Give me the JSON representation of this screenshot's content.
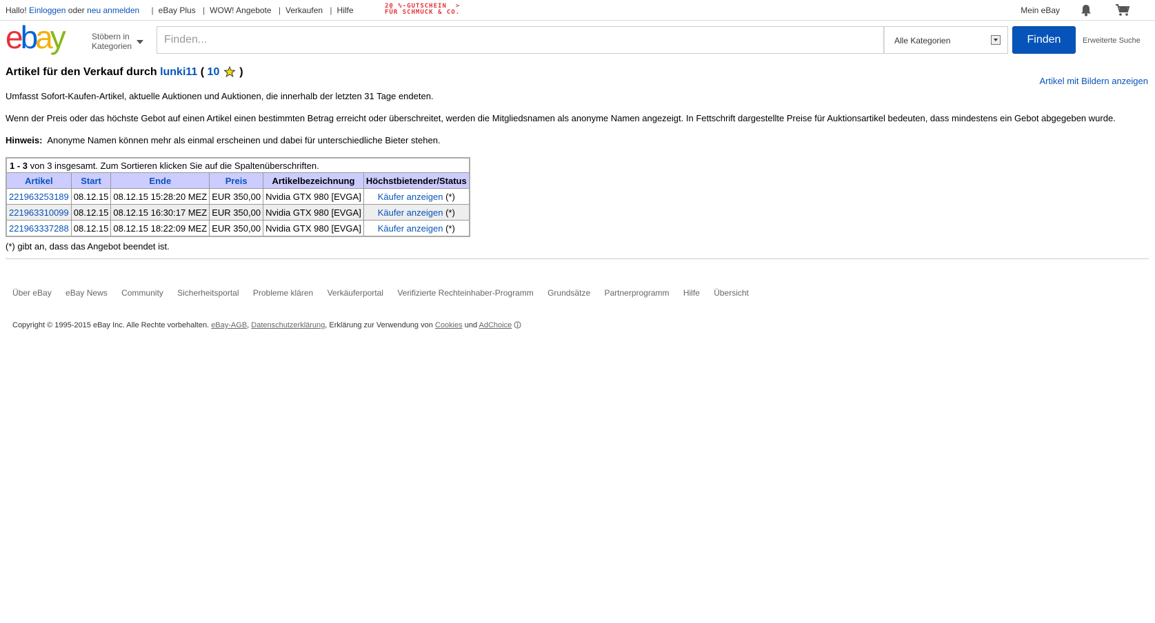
{
  "topbar": {
    "greeting": "Hallo!",
    "login": "Einloggen",
    "or": "oder",
    "register": "neu anmelden",
    "links": [
      "eBay Plus",
      "WOW! Angebote",
      "Verkaufen",
      "Hilfe"
    ],
    "promo_line1": "20 %-GUTSCHEIN  >",
    "promo_line2": "FÜR SCHMUCK & CO.",
    "mein_ebay": "Mein eBay"
  },
  "header": {
    "browse_line1": "Stöbern in",
    "browse_line2": "Kategorien",
    "search_placeholder": "Finden...",
    "category": "Alle Kategorien",
    "find_button": "Finden",
    "advanced": "Erweiterte Suche"
  },
  "page": {
    "title_prefix": "Artikel für den Verkauf durch",
    "seller": "lunki11",
    "open_paren": "(",
    "rating": "10",
    "close_paren": ")",
    "pictures_link": "Artikel mit Bildern anzeigen",
    "para1": "Umfasst Sofort-Kaufen-Artikel, aktuelle Auktionen und Auktionen, die innerhalb der letzten 31 Tage endeten.",
    "para2": "Wenn der Preis oder das höchste Gebot auf einen Artikel einen bestimmten Betrag erreicht oder überschreitet, werden die Mitgliedsnamen als anonyme Namen angezeigt. In Fettschrift dargestellte Preise für Auktionsartikel bedeuten, dass mindestens ein Gebot abgegeben wurde.",
    "hint_label": "Hinweis:",
    "hint_text": "Anonyme Namen können mehr als einmal erscheinen und dabei für unterschiedliche Bieter stehen."
  },
  "table": {
    "caption_range": "1 - 3",
    "caption_rest": "von 3 insgesamt. Zum Sortieren klicken Sie auf die Spaltenüberschriften.",
    "headers": [
      "Artikel",
      "Start",
      "Ende",
      "Preis",
      "Artikelbezeichnung",
      "Höchstbietender/Status"
    ],
    "rows": [
      {
        "id": "221963253189",
        "start": "08.12.15",
        "end": "08.12.15 15:28:20 MEZ",
        "price": "EUR 350,00",
        "title": "Nvidia GTX 980 [EVGA]",
        "status_link": "Käufer anzeigen",
        "status_mark": "(*)"
      },
      {
        "id": "221963310099",
        "start": "08.12.15",
        "end": "08.12.15 16:30:17 MEZ",
        "price": "EUR 350,00",
        "title": "Nvidia GTX 980 [EVGA]",
        "status_link": "Käufer anzeigen",
        "status_mark": "(*)"
      },
      {
        "id": "221963337288",
        "start": "08.12.15",
        "end": "08.12.15 18:22:09 MEZ",
        "price": "EUR 350,00",
        "title": "Nvidia GTX 980 [EVGA]",
        "status_link": "Käufer anzeigen",
        "status_mark": "(*)"
      }
    ],
    "footnote": "(*) gibt an, dass das Angebot beendet ist."
  },
  "footer": {
    "links": [
      "Über eBay",
      "eBay News",
      "Community",
      "Sicherheitsportal",
      "Probleme klären",
      "Verkäuferportal",
      "Verifizierte Rechteinhaber-Programm",
      "Grundsätze",
      "Partnerprogramm",
      "Hilfe",
      "Übersicht"
    ],
    "copyright": "Copyright © 1995-2015 eBay Inc. Alle Rechte vorbehalten.",
    "agb": "eBay-AGB",
    "privacy": "Datenschutzerklärung",
    "cookies_pre": ", Erklärung zur Verwendung von",
    "cookies": "Cookies",
    "and": "und",
    "adchoice": "AdChoice"
  },
  "colors": {
    "link": "#0654ba",
    "find_button": "#0654ba",
    "header_row": "#ccccff",
    "promo": "#e53238"
  }
}
